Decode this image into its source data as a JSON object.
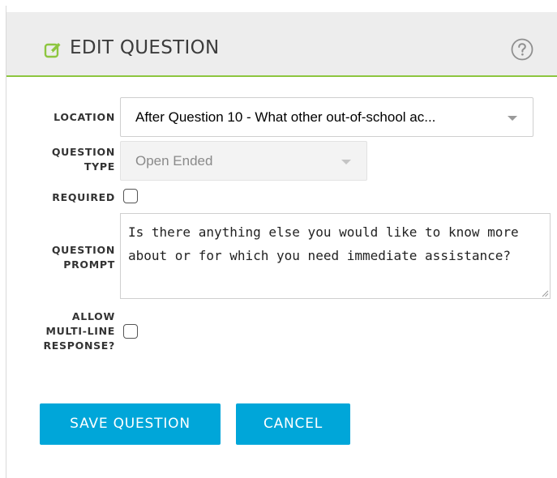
{
  "header": {
    "title": "EDIT QUESTION",
    "title_icon": "edit-icon",
    "help_icon": "question-circle-icon"
  },
  "form": {
    "location": {
      "label": "LOCATION",
      "value": "After Question 10 - What other out-of-school ac..."
    },
    "question_type": {
      "label_line1": "QUESTION",
      "label_line2": "TYPE",
      "value": "Open Ended",
      "disabled": true
    },
    "required": {
      "label": "REQUIRED",
      "checked": false
    },
    "question_prompt": {
      "label_line1": "QUESTION",
      "label_line2": "PROMPT",
      "value": "Is there anything else you would like to know more about or for which you need immediate assistance?"
    },
    "allow_multiline": {
      "label_line1": "ALLOW",
      "label_line2": "MULTI-LINE",
      "label_line3": "RESPONSE?",
      "checked": false
    }
  },
  "actions": {
    "save_label": "SAVE QUESTION",
    "cancel_label": "CANCEL"
  },
  "colors": {
    "accent_green": "#8dc63f",
    "button_blue": "#00a6d9",
    "header_bg": "#ededed"
  }
}
